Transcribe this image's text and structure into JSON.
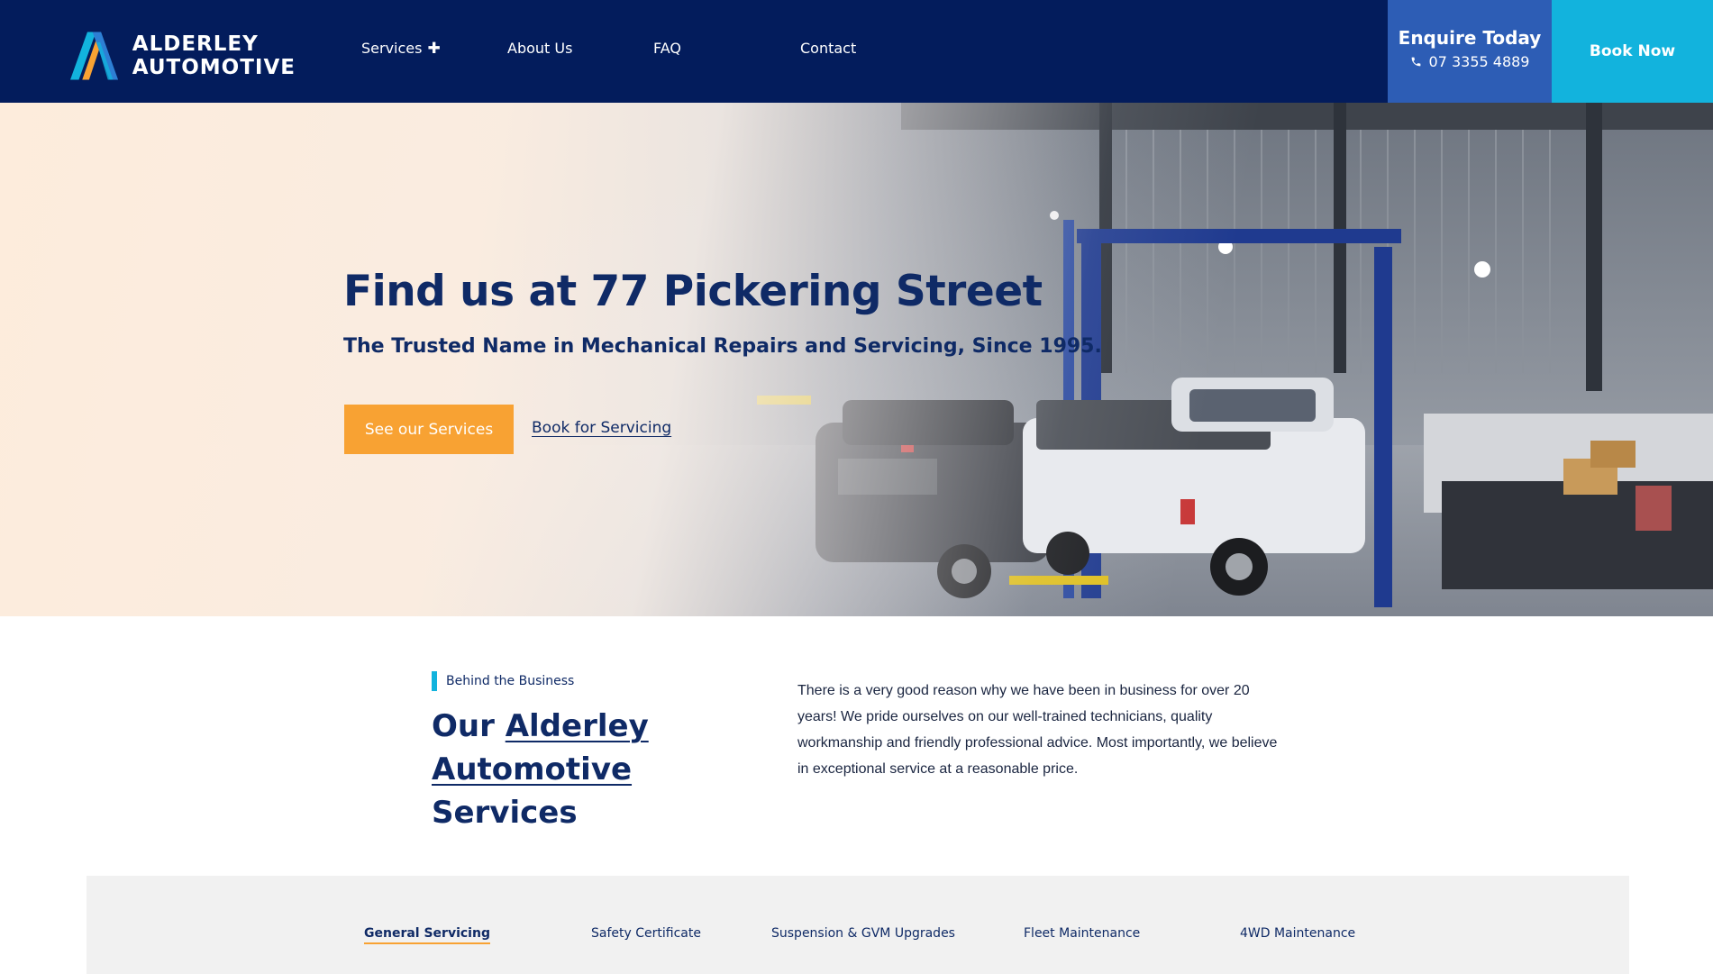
{
  "header": {
    "logo": {
      "line1": "ALDERLEY",
      "line2": "AUTOMOTIVE"
    },
    "nav": [
      {
        "label": "Services",
        "has_submenu": true
      },
      {
        "label": "About Us"
      },
      {
        "label": "FAQ"
      },
      {
        "label": "Contact"
      }
    ],
    "enquire": {
      "title": "Enquire Today",
      "phone": "07 3355 4889"
    },
    "book_now": "Book Now"
  },
  "hero": {
    "title": "Find us at 77 Pickering Street",
    "subtitle": "The Trusted Name in Mechanical Repairs and Servicing, Since 1995.",
    "primary_button": "See our Services",
    "secondary_link": "Book for Servicing"
  },
  "about": {
    "kicker": "Behind the Business",
    "title_prefix": "Our ",
    "title_link_1": "Alderley",
    "title_link_2": "Automotive",
    "title_suffix": " Services",
    "body": "There is a very good reason why we have been in business for over 20 years! We pride ourselves on our well-trained technicians, quality workmanship and friendly professional advice. Most importantly, we believe in exceptional service at a reasonable price."
  },
  "tabs": {
    "items": [
      {
        "label": "General Servicing",
        "active": true
      },
      {
        "label": "Safety Certificate",
        "active": false
      },
      {
        "label": "Suspension & GVM Upgrades",
        "active": false
      },
      {
        "label": "Fleet Maintenance",
        "active": false
      },
      {
        "label": "4WD Maintenance",
        "active": false
      }
    ]
  },
  "colors": {
    "navy": "#031c5c",
    "text_navy": "#0f2a66",
    "enquire_blue": "#2d5db5",
    "cyan": "#12b3dd",
    "orange": "#f8a233"
  },
  "icons": [
    "alderley-logo-icon",
    "plus-icon",
    "phone-icon"
  ]
}
